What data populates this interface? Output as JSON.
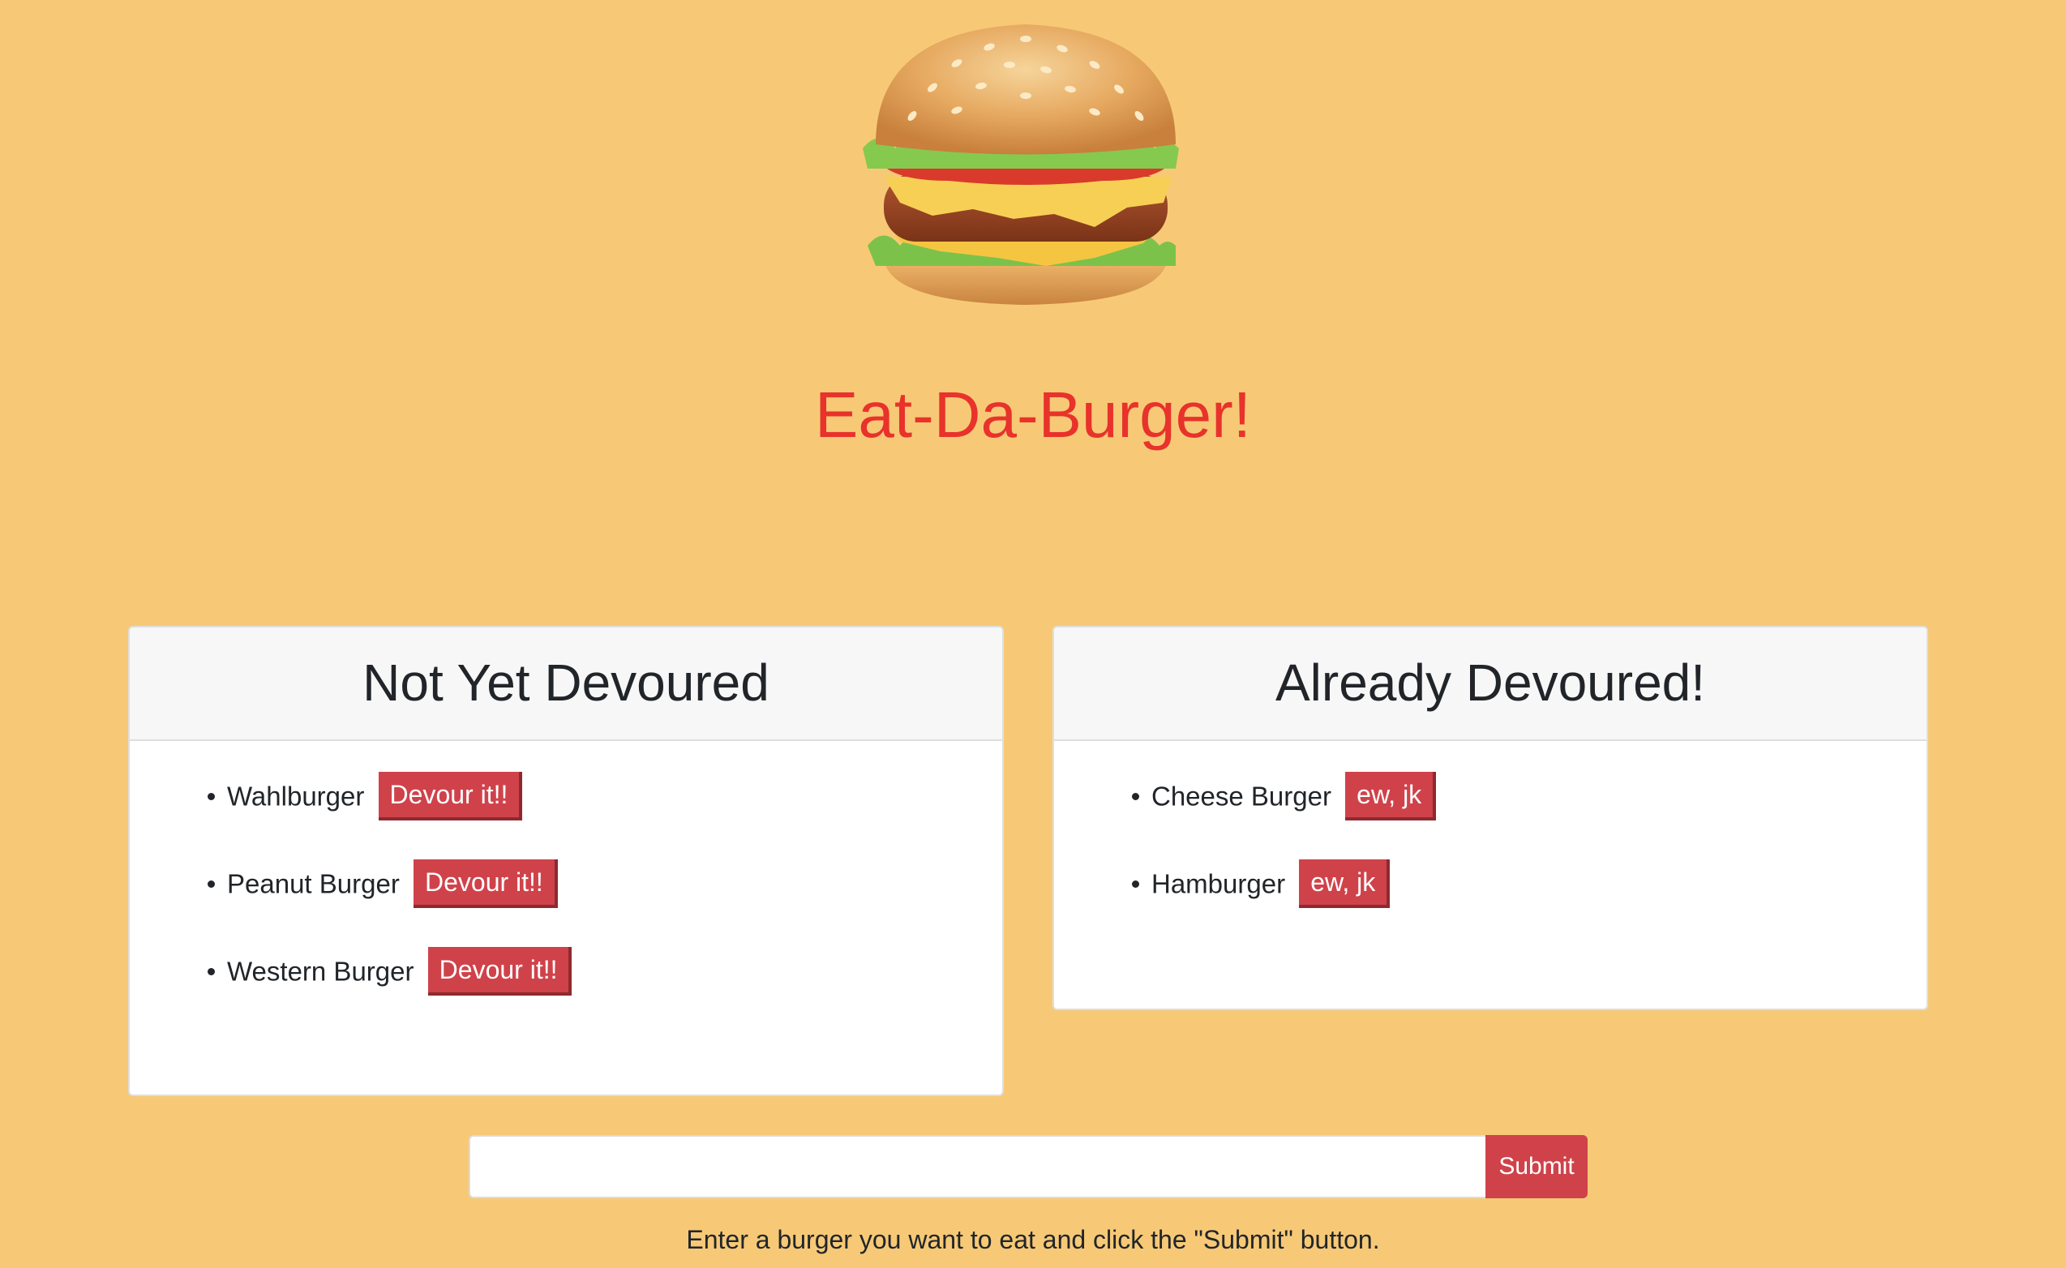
{
  "header": {
    "title": "Eat-Da-Burger!",
    "logo_icon": "hamburger-icon"
  },
  "not_devoured": {
    "heading": "Not Yet Devoured",
    "items": [
      {
        "name": "Wahlburger",
        "action": "Devour it!!"
      },
      {
        "name": "Peanut Burger",
        "action": "Devour it!!"
      },
      {
        "name": "Western Burger",
        "action": "Devour it!!"
      }
    ]
  },
  "devoured": {
    "heading": "Already Devoured!",
    "items": [
      {
        "name": "Cheese Burger",
        "action": "ew, jk"
      },
      {
        "name": "Hamburger",
        "action": "ew, jk"
      }
    ]
  },
  "form": {
    "input_value": "",
    "submit_label": "Submit",
    "help_text": "Enter a burger you want to eat and click the \"Submit\" button."
  },
  "colors": {
    "background": "#f7c976",
    "title": "#e8322b",
    "button": "#d0424a"
  }
}
